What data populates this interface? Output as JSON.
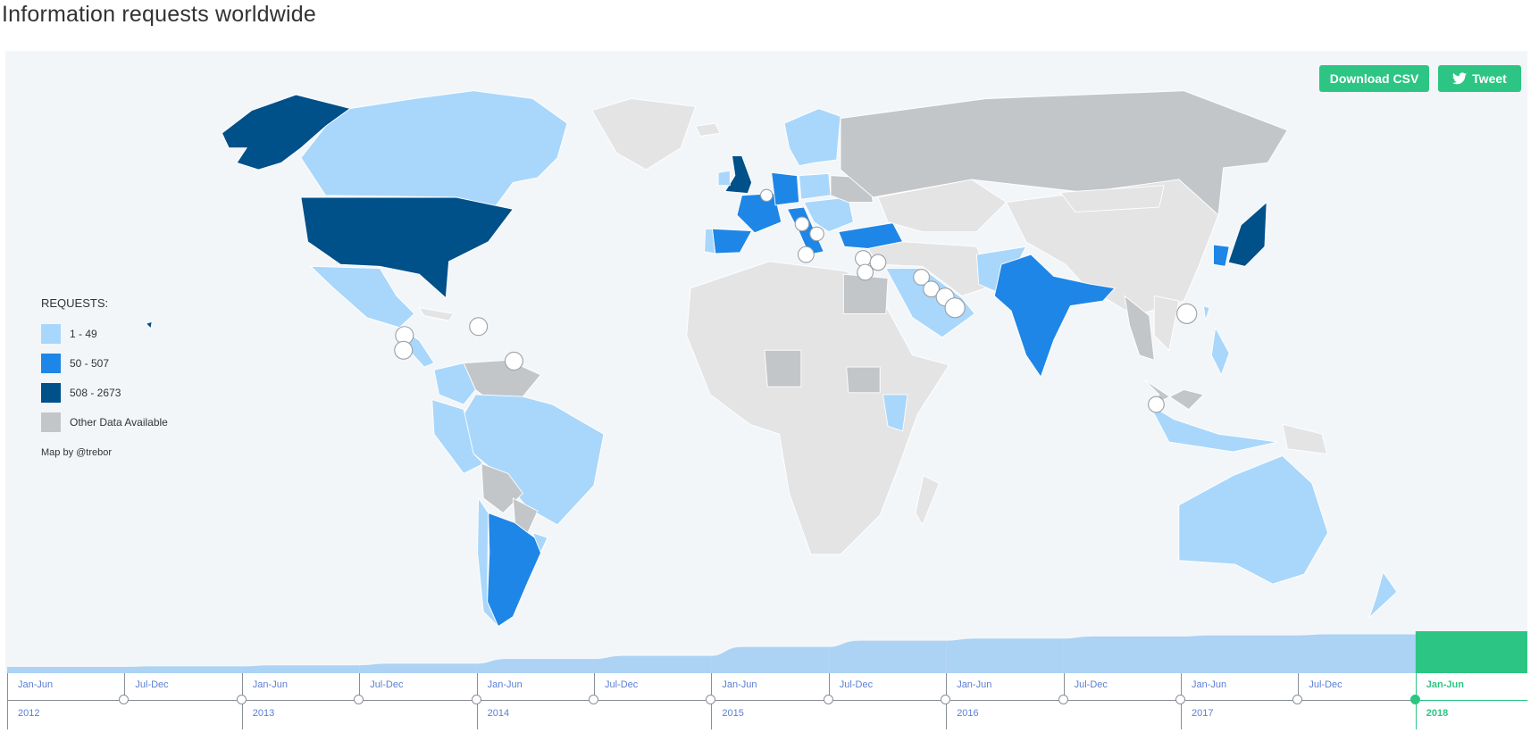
{
  "title": "Information requests worldwide",
  "buttons": {
    "download": "Download CSV",
    "tweet": "Tweet"
  },
  "icons": {
    "tweet": "twitter-bird-icon"
  },
  "legend": {
    "title": "REQUESTS:",
    "items": [
      {
        "label": "1 - 49",
        "color": "#a9d7fb"
      },
      {
        "label": "50 - 507",
        "color": "#1e86e6"
      },
      {
        "label": "508 - 2673",
        "color": "#00508a"
      },
      {
        "label": "Other Data Available",
        "color": "#c3c6c9"
      }
    ]
  },
  "credit": "Map by @trebor",
  "colors": {
    "accent": "#2dc583",
    "no_data": "#e4e4e4",
    "background": "#f3f6f9",
    "area": "#acd2f4",
    "timeline_text": "#5b7fd4"
  },
  "timeline": {
    "periods": [
      {
        "half": "Jan-Jun",
        "year": "2012",
        "volume_relative": 12
      },
      {
        "half": "Jul-Dec",
        "year": "",
        "volume_relative": 13
      },
      {
        "half": "Jan-Jun",
        "year": "2013",
        "volume_relative": 15
      },
      {
        "half": "Jul-Dec",
        "year": "",
        "volume_relative": 18
      },
      {
        "half": "Jan-Jun",
        "year": "2014",
        "volume_relative": 27
      },
      {
        "half": "Jul-Dec",
        "year": "",
        "volume_relative": 33
      },
      {
        "half": "Jan-Jun",
        "year": "2015",
        "volume_relative": 50
      },
      {
        "half": "Jul-Dec",
        "year": "",
        "volume_relative": 62
      },
      {
        "half": "Jan-Jun",
        "year": "2016",
        "volume_relative": 66
      },
      {
        "half": "Jul-Dec",
        "year": "",
        "volume_relative": 70
      },
      {
        "half": "Jan-Jun",
        "year": "2017",
        "volume_relative": 72
      },
      {
        "half": "Jul-Dec",
        "year": "",
        "volume_relative": 74
      },
      {
        "half": "Jan-Jun",
        "year": "2018",
        "volume_relative": 80
      }
    ],
    "selected_index": 12
  }
}
